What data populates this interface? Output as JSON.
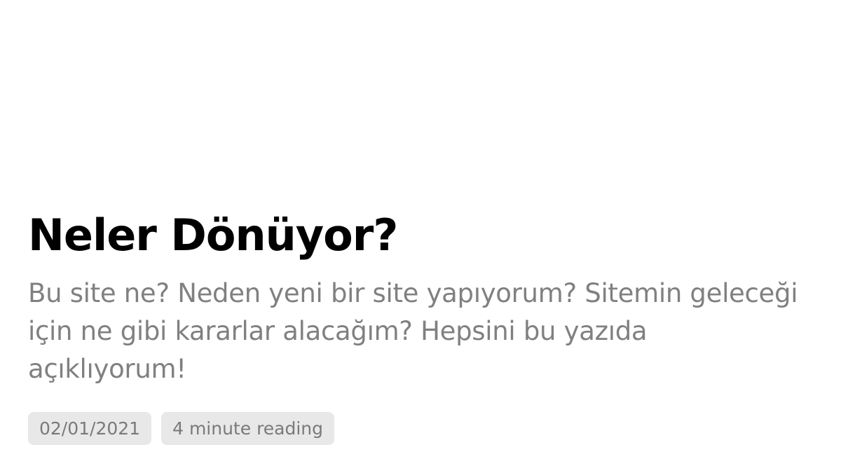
{
  "post": {
    "title": "Neler Dönüyor?",
    "description": "Bu site ne? Neden yeni bir site yapıyorum? Sitemin geleceği için ne gibi kararlar alacağım? Hepsini bu yazıda açıklıyorum!",
    "date": "02/01/2021",
    "reading_time": "4 minute reading"
  },
  "colors": {
    "title": "#000000",
    "description": "#808080",
    "badge_background": "#e8e8e8",
    "badge_text": "#7a7a7a"
  }
}
